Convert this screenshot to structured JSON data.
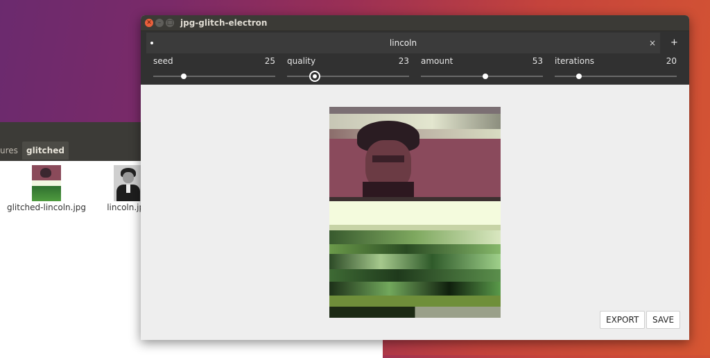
{
  "file_manager": {
    "tabs": [
      {
        "label": "ures"
      },
      {
        "label": "glitched"
      }
    ],
    "files": [
      {
        "name": "glitched-lincoln.jpg"
      },
      {
        "name": "lincoln.jpg"
      }
    ]
  },
  "app": {
    "window_title": "jpg-glitch-electron",
    "tab": {
      "title": "lincoln",
      "close_symbol": "×",
      "add_symbol": "+"
    },
    "controls": [
      {
        "name": "seed",
        "value": "25",
        "level": 0.25
      },
      {
        "name": "quality",
        "value": "23",
        "level": 0.23
      },
      {
        "name": "amount",
        "value": "53",
        "level": 0.53
      },
      {
        "name": "iterations",
        "value": "20",
        "level": 0.2
      }
    ],
    "buttons": {
      "export": "EXPORT",
      "save": "SAVE"
    }
  },
  "colors": {
    "close_button": "#e95f3c",
    "toolbar_bg": "#313131",
    "canvas_bg": "#eeeeee"
  }
}
